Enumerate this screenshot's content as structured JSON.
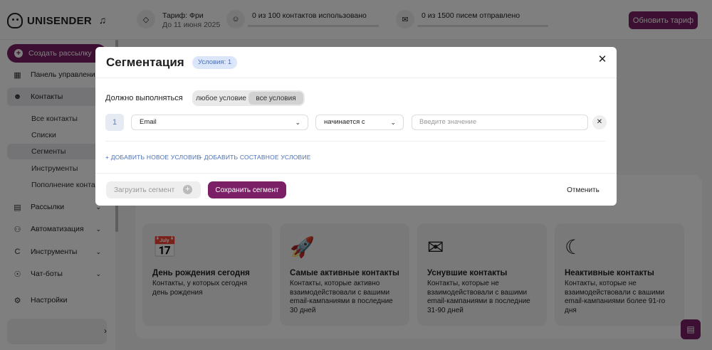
{
  "brand": {
    "name": "UNISENDER",
    "accent": "#7b1f66"
  },
  "topbar": {
    "tariff_label": "Тариф: Фри",
    "tariff_until": "До 11 июня 2025",
    "contacts_used": "0 из 100 контактов использовано",
    "emails_sent": "0 из 1500 писем отправлено",
    "upgrade_label": "Обновить тариф",
    "icons": {
      "tariff": "diamond-icon",
      "contacts": "user-icon",
      "emails": "mail-icon",
      "bell": "bell-icon"
    }
  },
  "sidebar": {
    "create_label": "Создать рассылку",
    "items": [
      {
        "label": "Панель управления",
        "icon": "dashboard-icon"
      },
      {
        "label": "Контакты",
        "icon": "contacts-icon"
      },
      {
        "label": "Рассылки",
        "icon": "mailings-icon"
      },
      {
        "label": "Автоматизация",
        "icon": "automation-icon"
      },
      {
        "label": "Инструменты",
        "icon": "tools-icon"
      },
      {
        "label": "Чат-боты",
        "icon": "chatbot-icon"
      },
      {
        "label": "Настройки",
        "icon": "settings-icon"
      }
    ],
    "contacts_sub": [
      "Все контакты",
      "Списки",
      "Сегменты",
      "Инструменты",
      "Пополнение контактов"
    ],
    "active_sub": "Сегменты"
  },
  "segments": [
    {
      "title": "День рождения сегодня",
      "desc": "Контакты, у которых сегодня день рождения",
      "icon": "birthday-calendar-icon"
    },
    {
      "title": "Самые активные контакты",
      "desc": "Контакты, которые активно взаимодействовали с вашими email-кампаниями в последние 30 дней",
      "icon": "rocket-icon"
    },
    {
      "title": "Уснувшие контакты",
      "desc": "Контакты, которые не взаимодействовали с вашими email-кампаниями в последние 31-90 дней",
      "icon": "sleeping-mail-icon"
    },
    {
      "title": "Неактивные контакты",
      "desc": "Контакты, которые не взаимодействовали с вашими email-кампаниями более 91-го дня",
      "icon": "moon-icon"
    }
  ],
  "modal": {
    "title": "Сегментация",
    "badge": "Условия: 1",
    "must_label": "Должно выполняться",
    "toggle": {
      "any": "любое условие",
      "all": "все условия",
      "selected": "все условия"
    },
    "condition": {
      "number": "1",
      "field": "Email",
      "operator": "начинается с",
      "value_placeholder": "Введите значение"
    },
    "add_condition": "+ ДОБАВИТЬ НОВОЕ УСЛОВИЕ",
    "add_compound": "+ ДОБАВИТЬ СОСТАВНОЕ УСЛОВИЕ",
    "load_label": "Загрузить сегмент",
    "save_label": "Сохранить сегмент",
    "cancel_label": "Отменить"
  }
}
